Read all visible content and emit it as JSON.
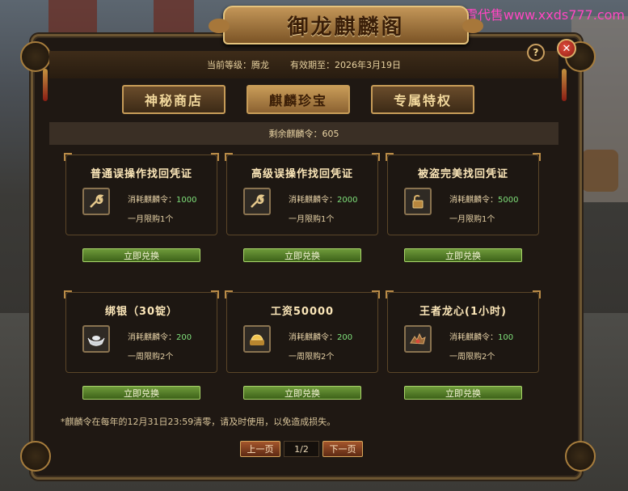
{
  "watermark": "小雪代售www.xxds777.com",
  "window": {
    "title": "御龙麒麟阁",
    "help_label": "?",
    "close_label": "✕"
  },
  "header": {
    "level_text": "当前等级：腾龙",
    "expire_text": "有效期至：2026年3月19日"
  },
  "tabs": [
    {
      "label": "神秘商店",
      "active": false
    },
    {
      "label": "麒麟珍宝",
      "active": true
    },
    {
      "label": "专属特权",
      "active": false
    }
  ],
  "remaining": "剩余麒麟令：605",
  "items": [
    {
      "title": "普通误操作找回凭证",
      "cost_label": "消耗麒麟令：",
      "cost": "1000",
      "limit": "一月限购1个",
      "icon": "wrench-icon",
      "button": "立即兑换"
    },
    {
      "title": "高级误操作找回凭证",
      "cost_label": "消耗麒麟令：",
      "cost": "2000",
      "limit": "一月限购1个",
      "icon": "wrench-icon",
      "button": "立即兑换"
    },
    {
      "title": "被盗完美找回凭证",
      "cost_label": "消耗麒麟令：",
      "cost": "5000",
      "limit": "一月限购1个",
      "icon": "lock-icon",
      "button": "立即兑换"
    },
    {
      "title": "绑银（30锭）",
      "cost_label": "消耗麒麟令：",
      "cost": "200",
      "limit": "一周限购2个",
      "icon": "silver-ingot-icon",
      "button": "立即兑换"
    },
    {
      "title": "工资50000",
      "cost_label": "消耗麒麟令：",
      "cost": "200",
      "limit": "一周限购2个",
      "icon": "gold-ingot-icon",
      "button": "立即兑换"
    },
    {
      "title": "王者龙心(1小时)",
      "cost_label": "消耗麒麟令：",
      "cost": "100",
      "limit": "一周限购2个",
      "icon": "dragon-heart-icon",
      "button": "立即兑换"
    }
  ],
  "notice": "*麒麟令在每年的12月31日23:59清零，请及时使用，以免造成损失。",
  "pager": {
    "prev": "上一页",
    "page": "1/2",
    "next": "下一页"
  },
  "colors": {
    "accent_gold": "#c79c58",
    "cost_green": "#7fe07a",
    "button_green": "#6e9a3a",
    "watermark_pink": "#ff47c2"
  }
}
